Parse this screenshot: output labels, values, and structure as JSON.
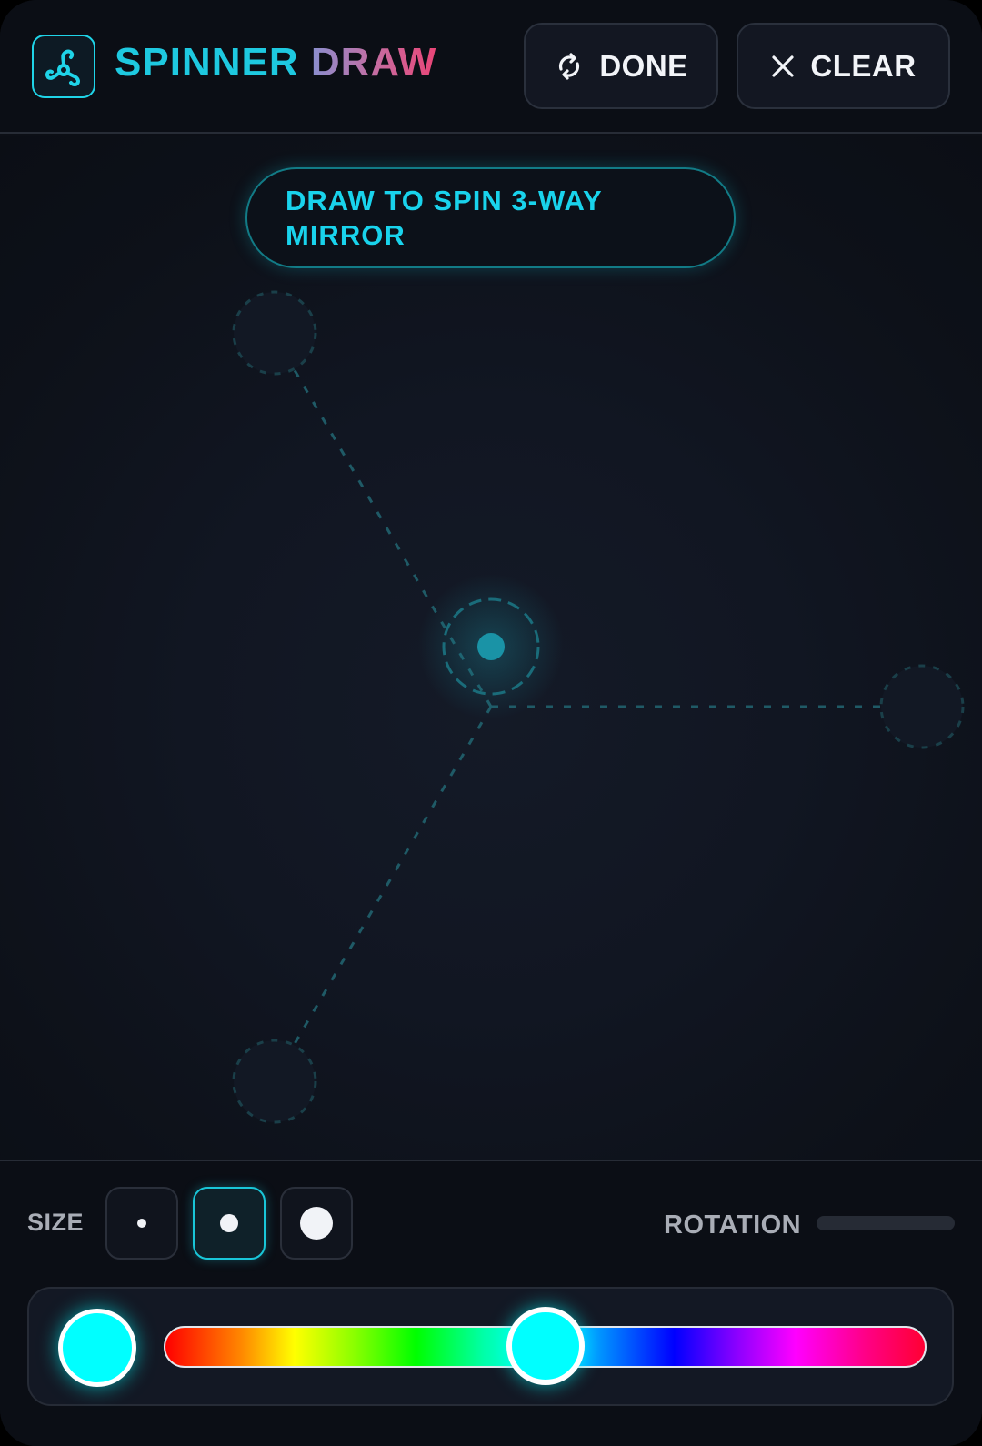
{
  "header": {
    "title_part1": "SPINNER",
    "title_part2": "DRAW",
    "done_label": "DONE",
    "clear_label": "CLEAR",
    "logo_icon": "spinner-logo-icon",
    "done_icon": "sync-icon",
    "clear_icon": "close-icon"
  },
  "canvas": {
    "hint_text": "DRAW TO SPIN 3-WAY MIRROR",
    "mirror_arms": 3
  },
  "toolbar": {
    "size_label": "SIZE",
    "sizes": [
      "small",
      "medium",
      "large"
    ],
    "selected_size": "medium",
    "rotation_label": "ROTATION",
    "rotation_value": 0,
    "selected_color": "#00ffff",
    "hue_position": 0.5
  },
  "colors": {
    "accent": "#19d3ec",
    "title_gradient_end": "#ea4577",
    "background": "#0c0f16"
  }
}
